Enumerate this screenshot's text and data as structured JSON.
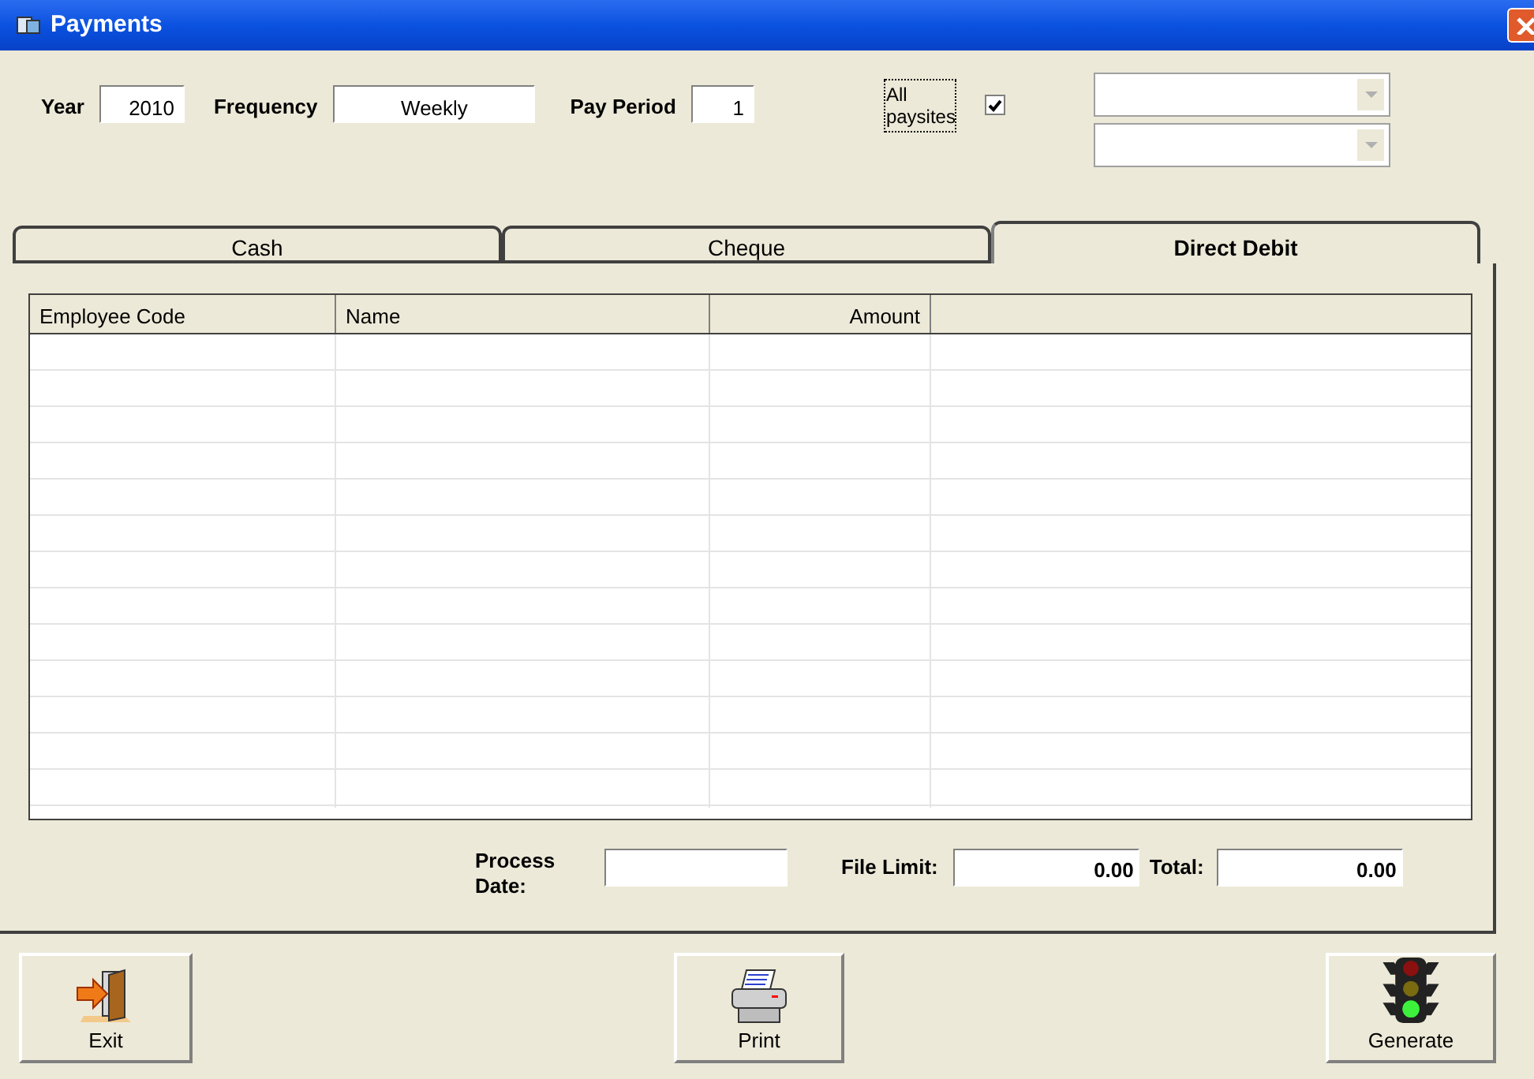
{
  "window": {
    "title": "Payments"
  },
  "filters": {
    "year": {
      "label": "Year",
      "value": "2010"
    },
    "frequency": {
      "label": "Frequency",
      "value": "Weekly"
    },
    "pay_period": {
      "label": "Pay Period",
      "value": "1"
    },
    "all_paysites": {
      "label": "All paysites",
      "checked": true
    }
  },
  "tabs": [
    {
      "label": "Cash",
      "selected": false
    },
    {
      "label": "Cheque",
      "selected": false
    },
    {
      "label": "Direct Debit",
      "selected": true
    }
  ],
  "table": {
    "columns": [
      {
        "label": "Employee Code"
      },
      {
        "label": "Name"
      },
      {
        "label": "Amount"
      }
    ]
  },
  "totals": {
    "process_date": {
      "label": "Process Date:"
    },
    "file_limit": {
      "label": "File Limit:",
      "value": "0.00"
    },
    "total": {
      "label": "Total:",
      "value": "0.00"
    }
  },
  "buttons": [
    {
      "kind": "exit",
      "label": "Exit"
    },
    {
      "kind": "print",
      "label": "Print"
    },
    {
      "kind": "generate",
      "label": "Generate"
    }
  ]
}
